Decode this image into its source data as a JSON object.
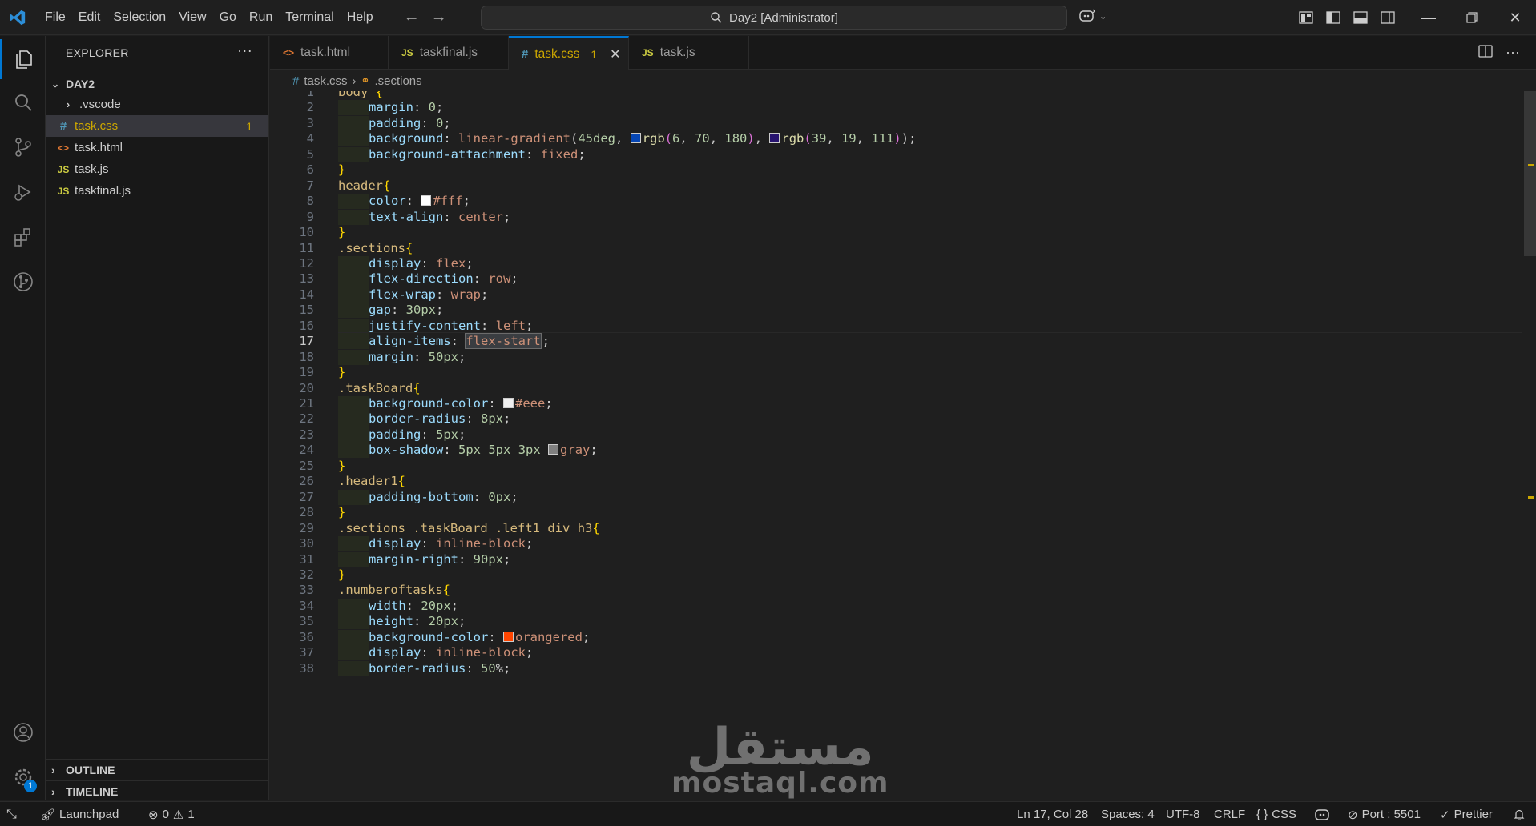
{
  "titlebar": {
    "menu": [
      "File",
      "Edit",
      "Selection",
      "View",
      "Go",
      "Run",
      "Terminal",
      "Help"
    ],
    "search_text": "Day2 [Administrator]"
  },
  "explorer": {
    "title": "EXPLORER",
    "folder": "DAY2",
    "items": [
      {
        "name": ".vscode",
        "type": "folder"
      },
      {
        "name": "task.css",
        "type": "css",
        "problems": "1",
        "selected": true
      },
      {
        "name": "task.html",
        "type": "html"
      },
      {
        "name": "task.js",
        "type": "js"
      },
      {
        "name": "taskfinal.js",
        "type": "js"
      }
    ],
    "outline": "OUTLINE",
    "timeline": "TIMELINE"
  },
  "tabs": [
    {
      "label": "task.html",
      "icon": "<>",
      "active": false
    },
    {
      "label": "taskfinal.js",
      "icon": "JS",
      "active": false
    },
    {
      "label": "task.css",
      "icon": "#",
      "active": true,
      "problems": "1"
    },
    {
      "label": "task.js",
      "icon": "JS",
      "active": false
    }
  ],
  "breadcrumb": {
    "file": "task.css",
    "symbol": ".sections"
  },
  "editor": {
    "current_line": 17,
    "lines": [
      {
        "n": "1",
        "t": "body {"
      },
      {
        "n": "2",
        "t": "    margin: 0;"
      },
      {
        "n": "3",
        "t": "    padding: 0;"
      },
      {
        "n": "4",
        "t": "    background: linear-gradient(45deg, rgb(6, 70, 180), rgb(39, 19, 111));"
      },
      {
        "n": "5",
        "t": "    background-attachment: fixed;"
      },
      {
        "n": "6",
        "t": "}"
      },
      {
        "n": "7",
        "t": "header{"
      },
      {
        "n": "8",
        "t": "    color: #fff;"
      },
      {
        "n": "9",
        "t": "    text-align: center;"
      },
      {
        "n": "10",
        "t": "}"
      },
      {
        "n": "11",
        "t": ".sections{"
      },
      {
        "n": "12",
        "t": "    display: flex;"
      },
      {
        "n": "13",
        "t": "    flex-direction: row;"
      },
      {
        "n": "14",
        "t": "    flex-wrap: wrap;"
      },
      {
        "n": "15",
        "t": "    gap: 30px;"
      },
      {
        "n": "16",
        "t": "    justify-content: left;"
      },
      {
        "n": "17",
        "t": "    align-items: flex-start;"
      },
      {
        "n": "18",
        "t": "    margin: 50px;"
      },
      {
        "n": "19",
        "t": "}"
      },
      {
        "n": "20",
        "t": ".taskBoard{"
      },
      {
        "n": "21",
        "t": "    background-color: #eee;"
      },
      {
        "n": "22",
        "t": "    border-radius: 8px;"
      },
      {
        "n": "23",
        "t": "    padding: 5px;"
      },
      {
        "n": "24",
        "t": "    box-shadow: 5px 5px 3px gray;"
      },
      {
        "n": "25",
        "t": "}"
      },
      {
        "n": "26",
        "t": ".header1{"
      },
      {
        "n": "27",
        "t": "    padding-bottom: 0px;"
      },
      {
        "n": "28",
        "t": "}"
      },
      {
        "n": "29",
        "t": ".sections .taskBoard .left1 div h3{"
      },
      {
        "n": "30",
        "t": "    display: inline-block;"
      },
      {
        "n": "31",
        "t": "    margin-right: 90px;"
      },
      {
        "n": "32",
        "t": "}"
      },
      {
        "n": "33",
        "t": ".numberoftasks{"
      },
      {
        "n": "34",
        "t": "    width: 20px;"
      },
      {
        "n": "35",
        "t": "    height: 20px;"
      },
      {
        "n": "36",
        "t": "    background-color: orangered;"
      },
      {
        "n": "37",
        "t": "    display: inline-block;"
      },
      {
        "n": "38",
        "t": "    border-radius: 50%;"
      }
    ],
    "swatches": {
      "rgb(6, 70, 180)": "#0646b4",
      "rgb(39, 19, 111)": "#27136f",
      "#fff": "#ffffff",
      "#eee": "#eeeeee",
      "gray": "#808080",
      "orangered": "#ff4500"
    }
  },
  "watermark": {
    "arabic": "مستقل",
    "latin": "mostaql.com"
  },
  "statusbar": {
    "launchpad": "Launchpad",
    "errors": "0",
    "warnings": "1",
    "position": "Ln 17, Col 28",
    "spaces": "Spaces: 4",
    "encoding": "UTF-8",
    "eol": "CRLF",
    "language": "CSS",
    "language_prefix": "{ }",
    "port": "Port : 5501",
    "prettier": "Prettier"
  },
  "colors": {
    "accent": "#0078d4",
    "warning": "#cca700",
    "editor_bg": "#1f1f1f",
    "sidebar_bg": "#181818"
  }
}
